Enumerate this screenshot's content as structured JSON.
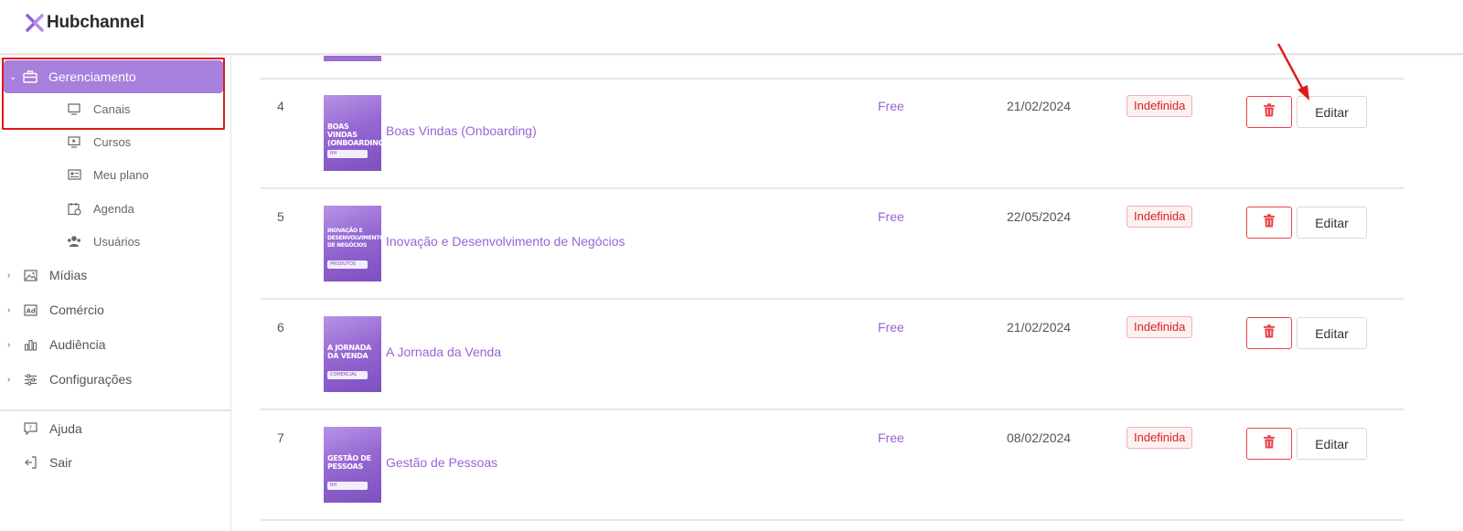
{
  "brand": {
    "name": "Hubchannel",
    "accent": "#a77fdc",
    "link_color": "#9b63d6"
  },
  "sidebar": {
    "active_section": {
      "label": "Gerenciamento",
      "icon": "briefcase-icon"
    },
    "sub_items": [
      {
        "label": "Canais",
        "icon": "monitor-icon"
      },
      {
        "label": "Cursos",
        "icon": "play-screen-icon"
      },
      {
        "label": "Meu plano",
        "icon": "id-card-icon"
      },
      {
        "label": "Agenda",
        "icon": "calendar-clock-icon"
      },
      {
        "label": "Usuários",
        "icon": "users-icon"
      }
    ],
    "sections": [
      {
        "label": "Mídias",
        "icon": "image-icon"
      },
      {
        "label": "Comércio",
        "icon": "ad-icon"
      },
      {
        "label": "Audiência",
        "icon": "bar-chart-icon"
      },
      {
        "label": "Configurações",
        "icon": "sliders-icon"
      }
    ],
    "footer": [
      {
        "label": "Ajuda",
        "icon": "help-icon"
      },
      {
        "label": "Sair",
        "icon": "logout-icon"
      }
    ]
  },
  "rows": [
    {
      "num": "4",
      "thumb_title": "BOAS VINDAS (ONBOARDING)",
      "thumb_tag": "RH",
      "title": "Boas Vindas (Onboarding)",
      "price": "Free",
      "date": "21/02/2024",
      "status": "Indefinida",
      "edit_label": "Editar"
    },
    {
      "num": "5",
      "thumb_title": "INOVAÇÃO E DESENVOLVIMENTO DE NEGÓCIOS",
      "thumb_tag": "PRODUTOS",
      "title": "Inovação e Desenvolvimento de Negócios",
      "price": "Free",
      "date": "22/05/2024",
      "status": "Indefinida",
      "edit_label": "Editar"
    },
    {
      "num": "6",
      "thumb_title": "A JORNADA DA VENDA",
      "thumb_tag": "COMERCIAL",
      "title": "A Jornada da Venda",
      "price": "Free",
      "date": "21/02/2024",
      "status": "Indefinida",
      "edit_label": "Editar"
    },
    {
      "num": "7",
      "thumb_title": "GESTÃO DE PESSOAS",
      "thumb_tag": "RH",
      "title": "Gestão de Pessoas",
      "price": "Free",
      "date": "08/02/2024",
      "status": "Indefinida",
      "edit_label": "Editar"
    }
  ],
  "colors": {
    "danger": "#e8434b",
    "badge_text": "#d8202a",
    "highlight_box": "#e01818"
  }
}
